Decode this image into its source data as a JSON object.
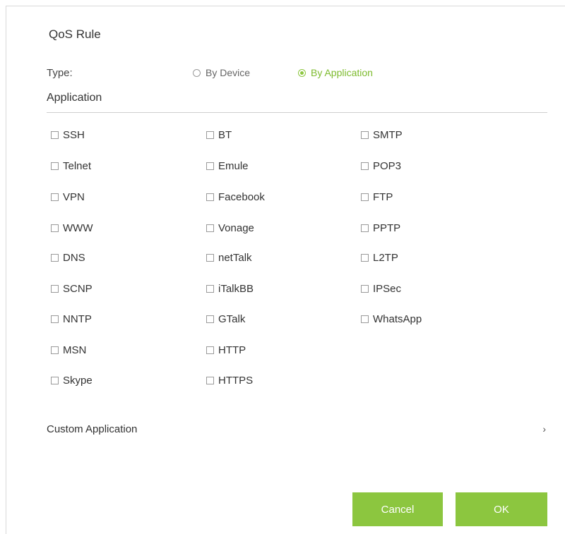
{
  "dialog": {
    "title": "QoS Rule",
    "type_label": "Type:",
    "type_options": [
      {
        "label": "By Device",
        "selected": false
      },
      {
        "label": "By Application",
        "selected": true
      }
    ],
    "section_title": "Application",
    "applications": [
      [
        "SSH",
        "Telnet",
        "VPN",
        "WWW",
        "DNS",
        "SCNP",
        "NNTP",
        "MSN",
        "Skype"
      ],
      [
        "BT",
        "Emule",
        "Facebook",
        "Vonage",
        "netTalk",
        "iTalkBB",
        "GTalk",
        "HTTP",
        "HTTPS"
      ],
      [
        "SMTP",
        "POP3",
        "FTP",
        "PPTP",
        "L2TP",
        "IPSec",
        "WhatsApp"
      ]
    ],
    "custom_application_label": "Custom Application",
    "cancel_label": "Cancel",
    "ok_label": "OK"
  },
  "colors": {
    "accent": "#8cc63f",
    "border": "#d9d9d9"
  },
  "icons": {
    "custom_chevron": "chevron-right-icon"
  }
}
